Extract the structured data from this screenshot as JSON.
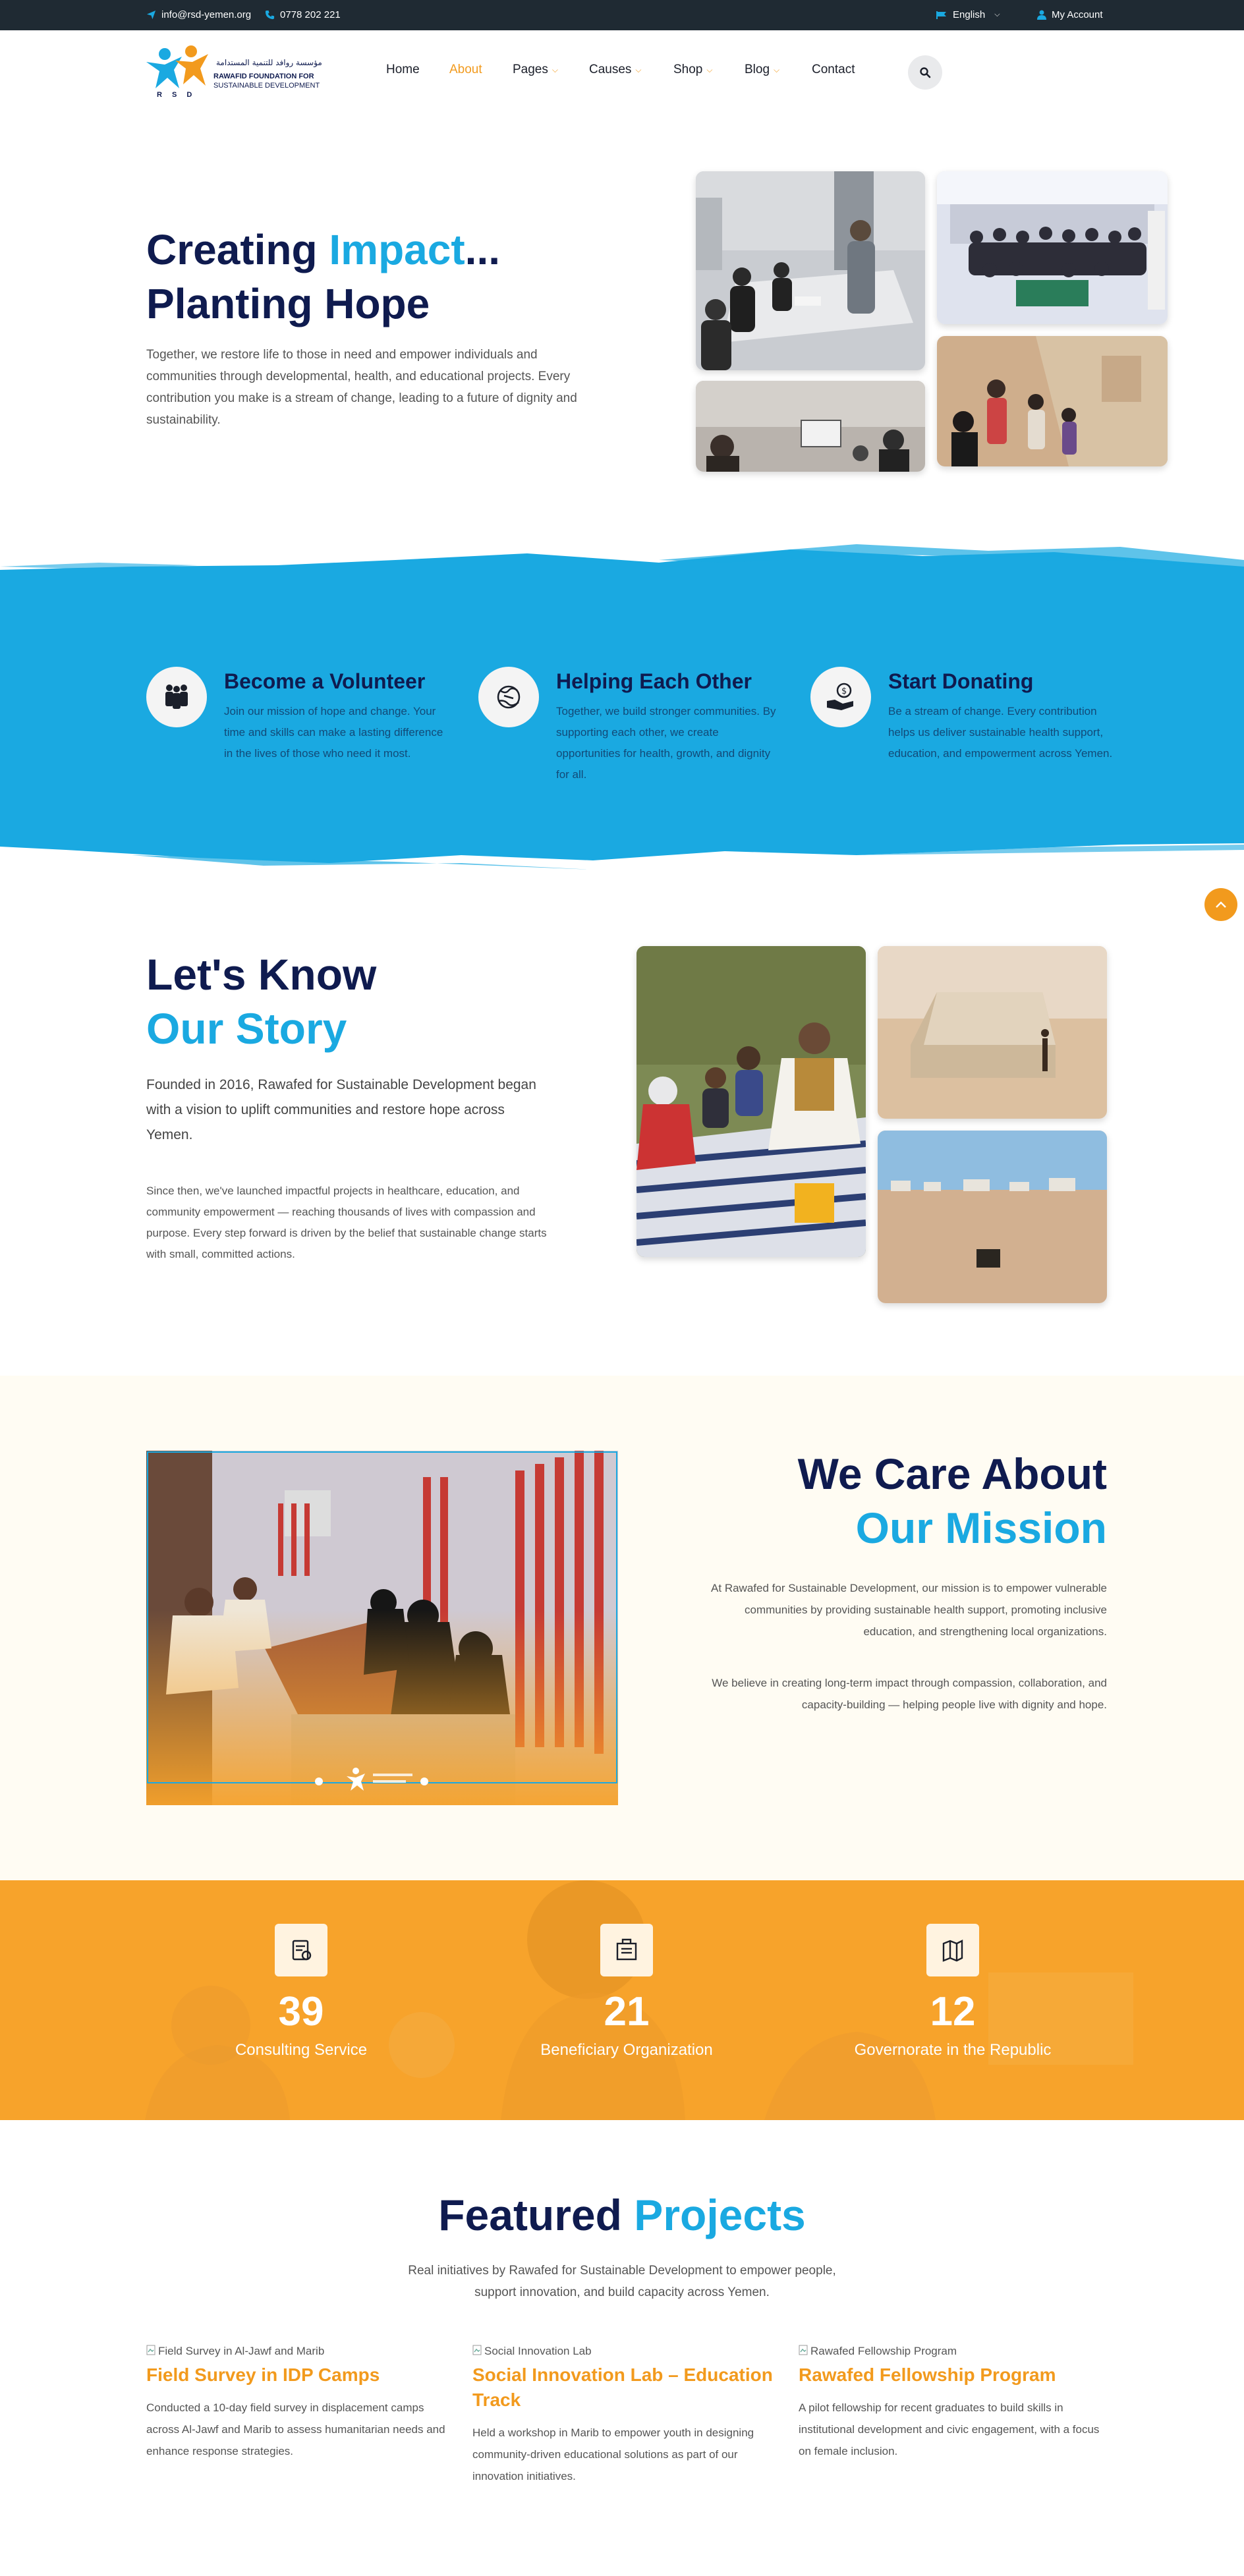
{
  "topbar": {
    "email": "info@rsd-yemen.org",
    "phone": "0778 202 221",
    "language": "English",
    "account": "My Account"
  },
  "brand": {
    "name_ar": "مؤسسة روافد للتنمية المستدامة",
    "name_en_line1": "RAWAFID FOUNDATION FOR",
    "name_en_line2": "SUSTAINABLE DEVELOPMENT",
    "initials": "R S D"
  },
  "nav": {
    "items": [
      {
        "label": "Home",
        "active": false,
        "dropdown": false
      },
      {
        "label": "About",
        "active": true,
        "dropdown": false
      },
      {
        "label": "Pages",
        "active": false,
        "dropdown": true
      },
      {
        "label": "Causes",
        "active": false,
        "dropdown": true
      },
      {
        "label": "Shop",
        "active": false,
        "dropdown": true
      },
      {
        "label": "Blog",
        "active": false,
        "dropdown": true
      },
      {
        "label": "Contact",
        "active": false,
        "dropdown": false
      }
    ]
  },
  "hero": {
    "title_part1": "Creating ",
    "title_highlight": "Impact",
    "title_part2": "...",
    "title_line2": "Planting Hope",
    "text": "Together, we restore life to those in need and empower individuals and communities through developmental, health, and educational projects. Every contribution you make is a stream of change, leading to a future of dignity and sustainability."
  },
  "features": [
    {
      "title": "Become a Volunteer",
      "icon": "volunteers-icon",
      "text": "Join our mission of hope and change. Your time and skills can make a lasting difference in the lives of those who need it most."
    },
    {
      "title": "Helping Each Other",
      "icon": "helping-hands-icon",
      "text": "Together, we build stronger communities. By supporting each other, we create opportunities for health, growth, and dignity for all."
    },
    {
      "title": "Start Donating",
      "icon": "donate-icon",
      "text": "Be a stream of change. Every contribution helps us deliver sustainable health support, education, and empowerment across Yemen."
    }
  ],
  "story": {
    "title_line1": "Let's Know",
    "title_line2": "Our Story",
    "lead": "Founded in 2016, Rawafed for Sustainable Development began with a vision to uplift communities and restore hope across Yemen.",
    "text": "Since then, we've launched impactful projects in healthcare, education, and community empowerment — reaching thousands of lives with compassion and purpose. Every step forward is driven by the belief that sustainable change starts with small, committed actions."
  },
  "mission": {
    "title_line1": "We Care About",
    "title_line2": "Our Mission",
    "text1": "At Rawafed for Sustainable Development, our mission is to empower vulnerable communities by providing sustainable health support, promoting inclusive education, and strengthening local organizations.",
    "text2": "We believe in creating long-term impact through compassion, collaboration, and capacity-building — helping people live with dignity and hope."
  },
  "stats": [
    {
      "value": "39",
      "label": "Consulting Service",
      "icon": "consulting-icon"
    },
    {
      "value": "21",
      "label": "Beneficiary Organization",
      "icon": "organization-icon"
    },
    {
      "value": "12",
      "label": "Governorate in the Republic",
      "icon": "map-icon"
    }
  ],
  "projects": {
    "title_part1": "Featured ",
    "title_highlight": "Projects",
    "subtitle": "Real initiatives by Rawafed for Sustainable Development to empower people, support innovation, and build capacity across Yemen.",
    "items": [
      {
        "image_alt": "Field Survey in Al-Jawf and Marib",
        "title": "Field Survey in IDP Camps",
        "text": "Conducted a 10-day field survey in displacement camps across Al-Jawf and Marib to assess humanitarian needs and enhance response strategies."
      },
      {
        "image_alt": "Social Innovation Lab",
        "title": "Social Innovation Lab – Education Track",
        "text": "Held a workshop in Marib to empower youth in designing community-driven educational solutions as part of our innovation initiatives."
      },
      {
        "image_alt": "Rawafed Fellowship Program",
        "title": "Rawafed Fellowship Program",
        "text": "A pilot fellowship for recent graduates to build skills in institutional development and civic engagement, with a focus on female inclusion."
      }
    ]
  },
  "colors": {
    "navy": "#0f1b4f",
    "accent_blue": "#1aa9e1",
    "accent_orange": "#f29a1d",
    "topbar": "#1f2a33",
    "stats_bg": "#f7a32b"
  }
}
